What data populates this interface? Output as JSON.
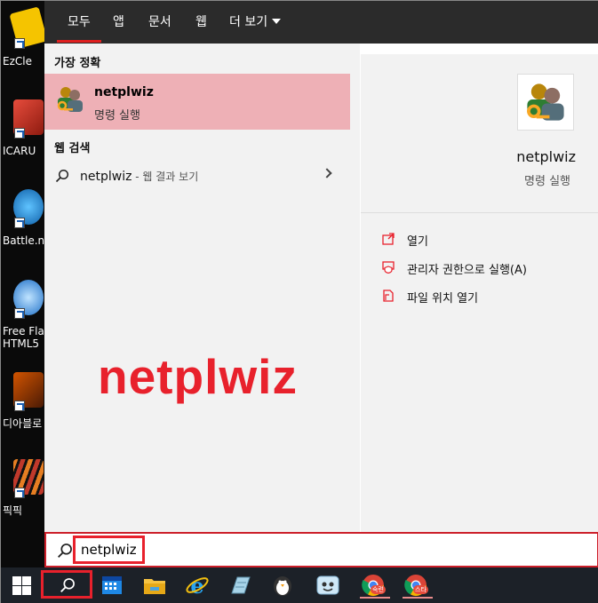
{
  "desktop": {
    "icons": [
      {
        "label": "EzCle",
        "icon": "ezclean-icon",
        "color": "#f5c400"
      },
      {
        "label": "ICARU",
        "icon": "icarus-icon",
        "color": "#c0392b"
      },
      {
        "label": "Battle.n",
        "icon": "battlenet-icon",
        "color": "#0e86d4"
      },
      {
        "label": "Free Flas",
        "label2": "HTML5",
        "icon": "flash-icon",
        "color": "#1e90ff"
      },
      {
        "label": "디아블로",
        "icon": "diablo-icon",
        "color": "#7a2d0c"
      },
      {
        "label": "픽픽",
        "icon": "picpick-icon",
        "color": "#e67e22"
      }
    ]
  },
  "tabs": {
    "all": "모두",
    "app": "앱",
    "doc": "문서",
    "web": "웹",
    "more": "더 보기"
  },
  "results": {
    "best_match_title": "가장 정확",
    "best_match_name": "netplwiz",
    "best_match_sub": "명령 실행",
    "web_title": "웹 검색",
    "web_query": "netplwiz",
    "web_suffix": " - 웹 결과 보기"
  },
  "overlay_text": "netplwiz",
  "detail": {
    "name": "netplwiz",
    "sub": "명령 실행",
    "actions": [
      {
        "label": "열기",
        "icon": "open-icon"
      },
      {
        "label": "관리자 권한으로 실행(A)",
        "icon": "admin-shield-icon"
      },
      {
        "label": "파일 위치 열기",
        "icon": "file-location-icon"
      }
    ]
  },
  "search": {
    "value": "netplwiz"
  },
  "taskbar": {
    "items": [
      {
        "name": "calendar-icon"
      },
      {
        "name": "file-explorer-icon"
      },
      {
        "name": "internet-explorer-icon"
      },
      {
        "name": "notepad-icon"
      },
      {
        "name": "penguin-app-icon"
      },
      {
        "name": "messenger-app-icon"
      },
      {
        "name": "chrome-icon",
        "badge": "숙련"
      },
      {
        "name": "chrome-icon",
        "badge": "스타"
      }
    ]
  },
  "colors": {
    "accent_red": "#e8212c",
    "best_match_bg": "#eeb0b6",
    "taskbar_bg": "#1c2128"
  }
}
